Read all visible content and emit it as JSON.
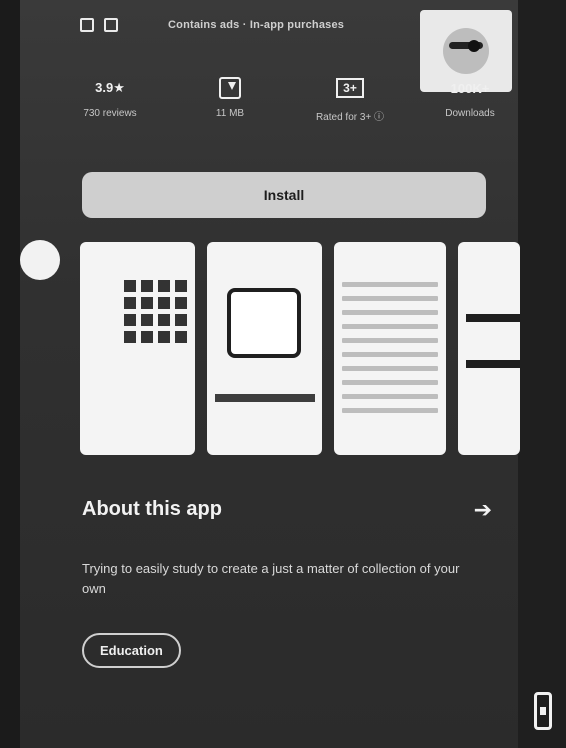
{
  "topbar": {
    "subtitle": "Contains ads · In-app purchases"
  },
  "stats": {
    "rating_value": "3.9★",
    "rating_label": "730 reviews",
    "downloads_label": "11 MB",
    "content_rating_badge": "3+",
    "content_rating_label": "Rated for 3+ ⓘ",
    "installs_value": "100K+",
    "installs_label": "Downloads"
  },
  "install": {
    "label": "Install"
  },
  "about": {
    "title": "About this app",
    "description": "Trying to easily study to create a just a matter of collection of your own",
    "chip_label": "Education"
  },
  "icons": {
    "top_left": "square-icon",
    "top_second": "edit-icon",
    "avatar": "pirate-skull-icon",
    "download": "download-icon",
    "about_arrow": "arrow-right-icon",
    "edge": "phone-icon"
  }
}
